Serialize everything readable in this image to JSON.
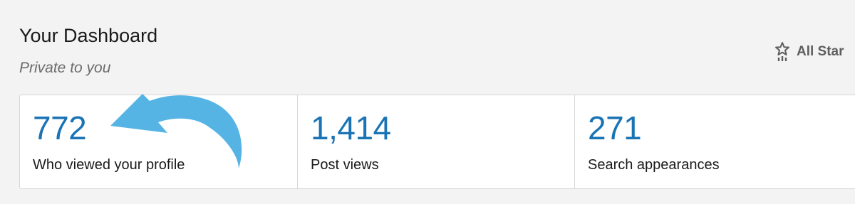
{
  "header": {
    "title": "Your Dashboard",
    "subtitle": "Private to you"
  },
  "all_star": {
    "label": "All Star",
    "icon": "all-star-icon"
  },
  "stats": [
    {
      "value": "772",
      "label": "Who viewed your profile"
    },
    {
      "value": "1,414",
      "label": "Post views"
    },
    {
      "value": "271",
      "label": "Search appearances"
    }
  ],
  "colors": {
    "background": "#f3f3f4",
    "card": "#ffffff",
    "stat_value": "#1a73b5",
    "annotation_arrow": "#56b4e4"
  },
  "annotation": {
    "icon": "curved-arrow-icon"
  }
}
